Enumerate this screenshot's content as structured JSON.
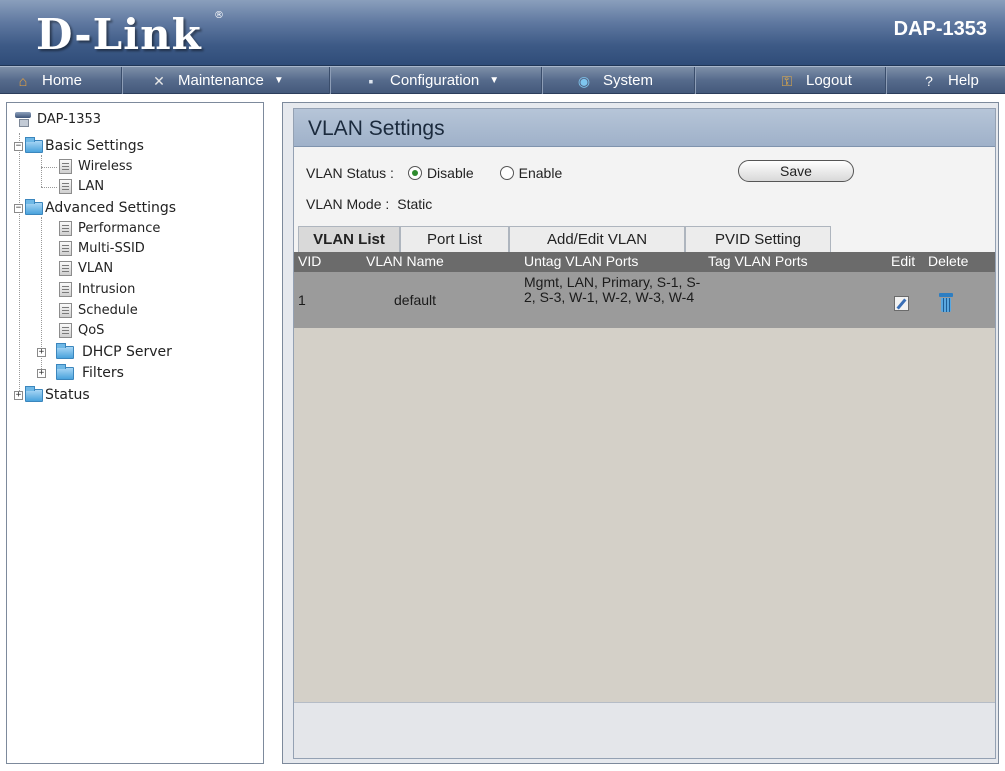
{
  "header": {
    "logo": "D-Link",
    "logo_mark": "®",
    "model": "DAP-1353"
  },
  "nav": {
    "home": "Home",
    "maintenance": "Maintenance",
    "configuration": "Configuration",
    "system": "System",
    "logout": "Logout",
    "help": "Help",
    "caret": "▼"
  },
  "sidebar": {
    "root": "DAP-1353",
    "basic_settings": "Basic Settings",
    "wireless": "Wireless",
    "lan": "LAN",
    "advanced_settings": "Advanced Settings",
    "performance": "Performance",
    "multi_ssid": "Multi-SSID",
    "vlan": "VLAN",
    "intrusion": "Intrusion",
    "schedule": "Schedule",
    "qos": "QoS",
    "dhcp_server": "DHCP Server",
    "filters": "Filters",
    "status": "Status"
  },
  "main": {
    "title": "VLAN Settings",
    "vlan_status_label": "VLAN Status :",
    "disable_label": "Disable",
    "enable_label": "Enable",
    "status_selected": "Disable",
    "vlan_mode_label": "VLAN Mode :",
    "vlan_mode_value": "Static",
    "save_label": "Save",
    "tabs": [
      "VLAN List",
      "Port List",
      "Add/Edit VLAN",
      "PVID Setting"
    ],
    "active_tab": "VLAN List",
    "table": {
      "headers": [
        "VID",
        "VLAN Name",
        "Untag VLAN Ports",
        "Tag VLAN Ports",
        "Edit",
        "Delete"
      ],
      "rows": [
        {
          "vid": "1",
          "name": "default",
          "untag_ports": "Mgmt, LAN, Primary, S-1, S-2, S-3, W-1, W-2, W-3, W-4",
          "tag_ports": ""
        }
      ]
    }
  },
  "colors": {
    "header": "#3d5a86",
    "panel_title": "#9fb1c9",
    "table_head": "#6b6b6b",
    "table_row": "#9b9b9b"
  }
}
